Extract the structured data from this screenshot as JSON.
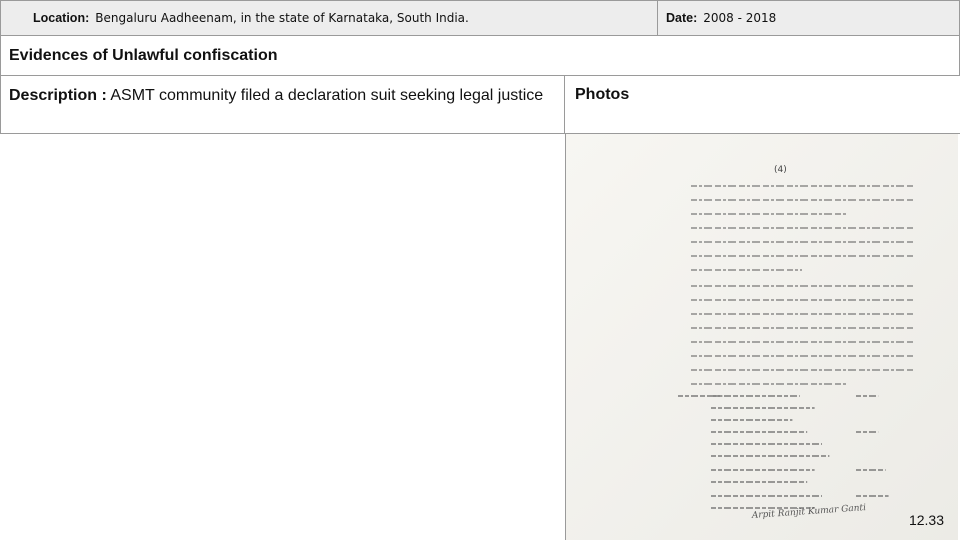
{
  "header": {
    "location_label": "Location:",
    "location_value": "Bengaluru Aadheenam, in the state of Karnataka, South India.",
    "date_label": "Date:",
    "date_value": "2008 - 2018"
  },
  "section_title": "Evidences of Unlawful confiscation",
  "description": {
    "label": "Description :",
    "text": "ASMT community filed a declaration suit seeking legal justice"
  },
  "photos_heading": "Photos",
  "photo": {
    "page_number": "(4)",
    "signatures": "Arpit   Ranjit Kumar Ganti"
  },
  "slide_number": "12.33"
}
